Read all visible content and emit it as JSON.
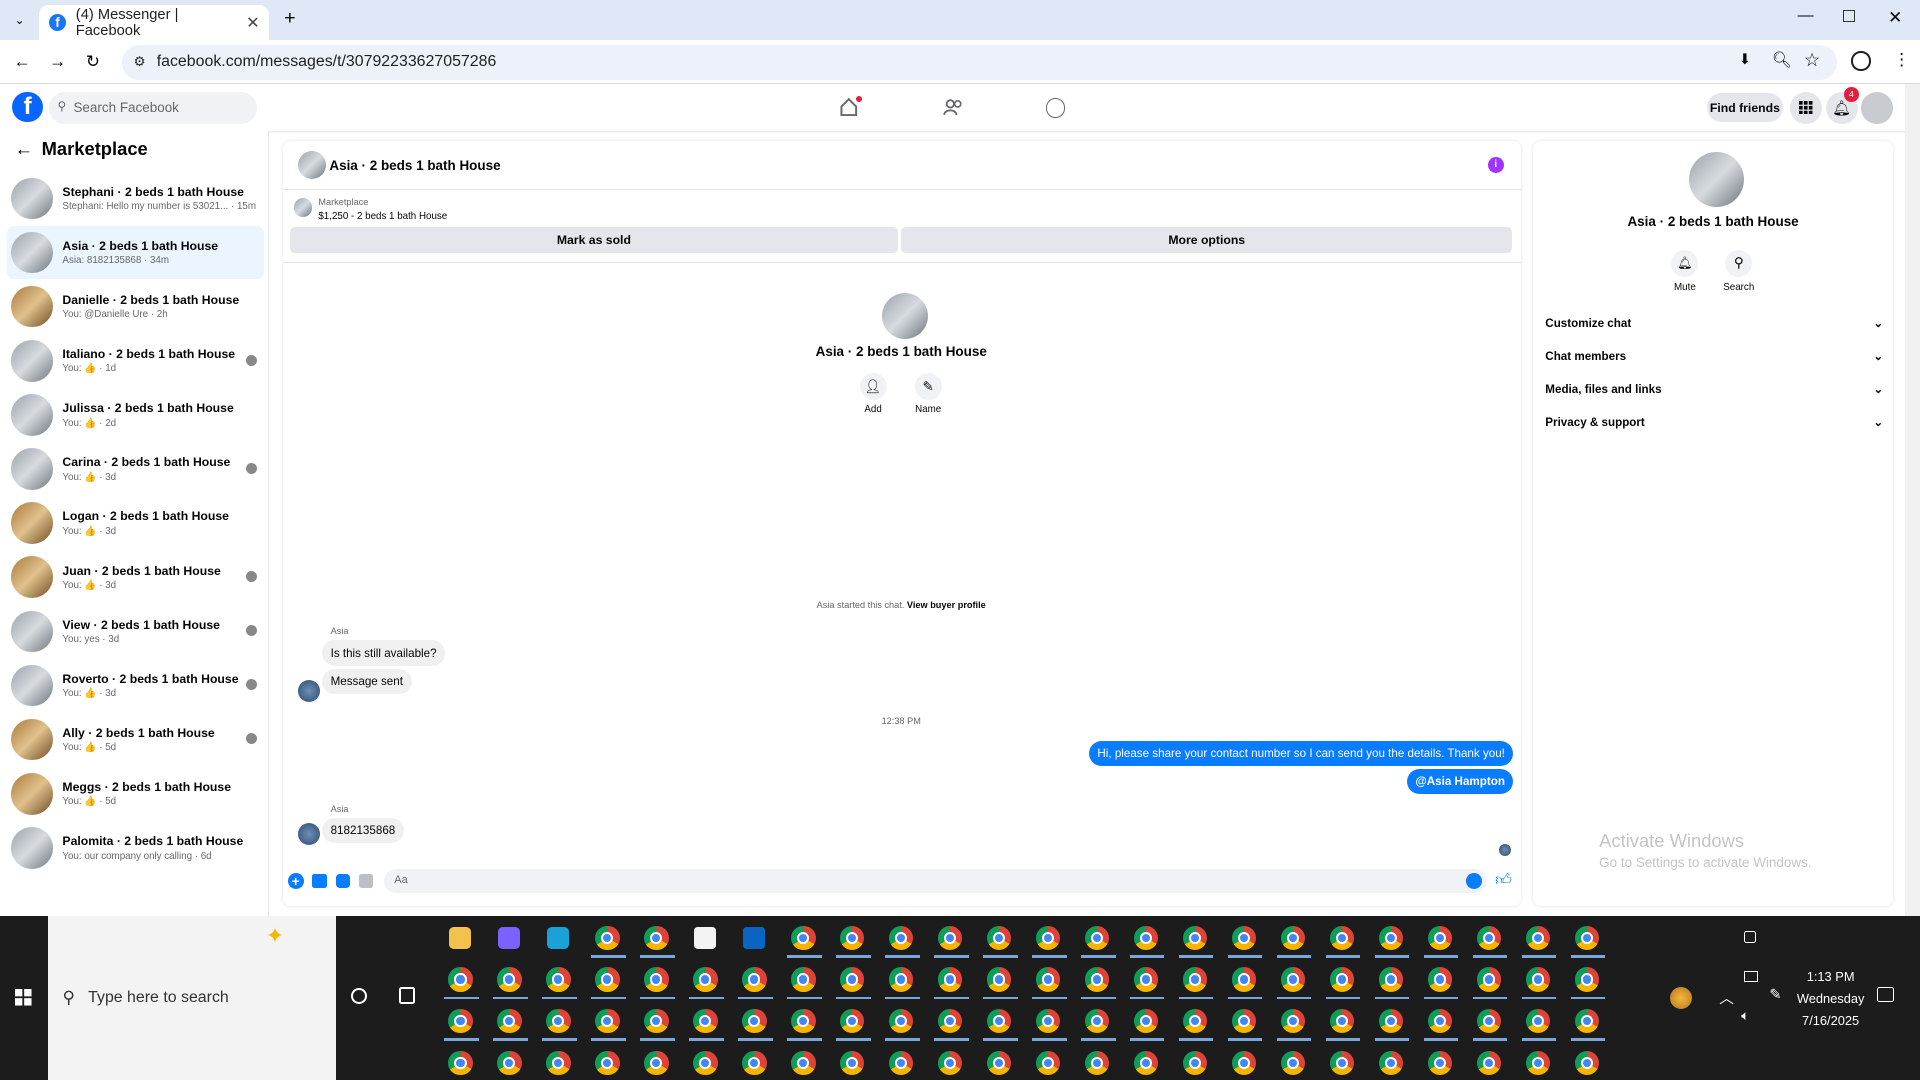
{
  "browser": {
    "tab_title": "(4) Messenger | Facebook",
    "url": "facebook.com/messages/t/30792233627057286"
  },
  "facebook": {
    "search_placeholder": "Search Facebook",
    "find_friends": "Find friends",
    "notifications_count": "4"
  },
  "sidebar": {
    "title": "Marketplace",
    "items": [
      {
        "name": "Stephani · 2 beds 1 bath House",
        "preview": "Stephani: Hello my number is 53021... · 15m"
      },
      {
        "name": "Asia · 2 beds 1 bath House",
        "preview": "Asia: 8182135868 · 34m"
      },
      {
        "name": "Danielle · 2 beds 1 bath House",
        "preview": "You: @Danielle Ure · 2h"
      },
      {
        "name": "Italiano · 2 beds 1 bath House",
        "preview": "You: 👍 · 1d"
      },
      {
        "name": "Julissa · 2 beds 1 bath House",
        "preview": "You: 👍 · 2d"
      },
      {
        "name": "Carina · 2 beds 1 bath House",
        "preview": "You: 👍 · 3d"
      },
      {
        "name": "Logan · 2 beds 1 bath House",
        "preview": "You: 👍 · 3d"
      },
      {
        "name": "Juan · 2 beds 1 bath House",
        "preview": "You: 👍 · 3d"
      },
      {
        "name": "View · 2 beds 1 bath House",
        "preview": "You: yes · 3d"
      },
      {
        "name": "Roverto · 2 beds 1 bath House",
        "preview": "You: 👍 · 3d"
      },
      {
        "name": "Ally · 2 beds 1 bath House",
        "preview": "You: 👍 · 5d"
      },
      {
        "name": "Meggs · 2 beds 1 bath House",
        "preview": "You: 👍 · 5d"
      },
      {
        "name": "Palomita · 2 beds 1 bath House",
        "preview": "You: our company only calling · 6d"
      }
    ]
  },
  "chat": {
    "title": "Asia · 2 beds 1 bath House",
    "listing_source": "Marketplace",
    "listing_info": "$1,250 - 2 beds 1 bath House",
    "mark_sold": "Mark as sold",
    "more_options": "More options",
    "profile_name": "Asia · 2 beds 1 bath House",
    "add_label": "Add",
    "name_label": "Name",
    "started_text": "Asia started this chat.",
    "view_buyer": "View buyer profile",
    "sender_label": "Asia",
    "msg1": "Is this still available?",
    "msg2": "Message sent",
    "timestamp": "12:38 PM",
    "out1": "Hi, please share your contact number so I can send you the details. Thank you!",
    "out2": "@Asia Hampton",
    "sender_label2": "Asia",
    "msg3": "8182135868",
    "composer_placeholder": "Aa"
  },
  "details": {
    "name": "Asia · 2 beds 1 bath House",
    "mute": "Mute",
    "search": "Search",
    "sections": [
      "Customize chat",
      "Chat members",
      "Media, files and links",
      "Privacy & support"
    ]
  },
  "watermark": {
    "line1": "Activate Windows",
    "line2": "Go to Settings to activate Windows."
  },
  "taskbar": {
    "search_placeholder": "Type here to search",
    "time": "1:13 PM",
    "day": "Wednesday",
    "date": "7/16/2025"
  }
}
